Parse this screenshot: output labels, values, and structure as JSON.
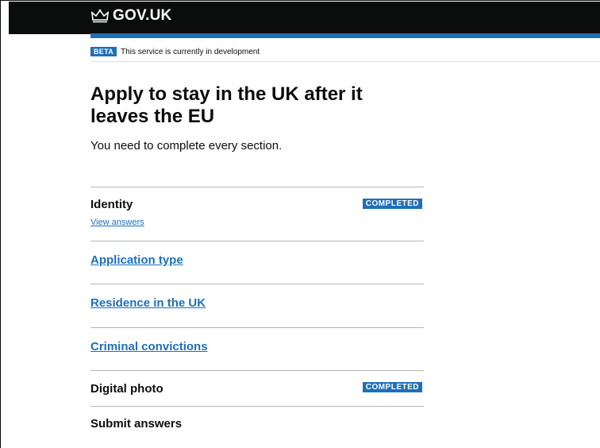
{
  "header": {
    "logo_text": "GOV.UK"
  },
  "phase_banner": {
    "tag": "BETA",
    "text": "This service is currently in development"
  },
  "page": {
    "title": "Apply to stay in the UK after it leaves the EU",
    "intro": "You need to complete every section."
  },
  "tasks": [
    {
      "name": "Identity",
      "sub_link": "View answers",
      "status": "COMPLETED",
      "is_link": false
    },
    {
      "name": "Application type",
      "is_link": true
    },
    {
      "name": "Residence in the UK",
      "is_link": true
    },
    {
      "name": "Criminal convictions",
      "is_link": true
    },
    {
      "name": "Digital photo",
      "status": "COMPLETED",
      "is_link": false
    },
    {
      "name": "Submit answers",
      "is_link": false
    }
  ],
  "colors": {
    "header_bg": "#0b0c0c",
    "brand_blue": "#1d70b8",
    "divider": "#b1b4b6"
  }
}
